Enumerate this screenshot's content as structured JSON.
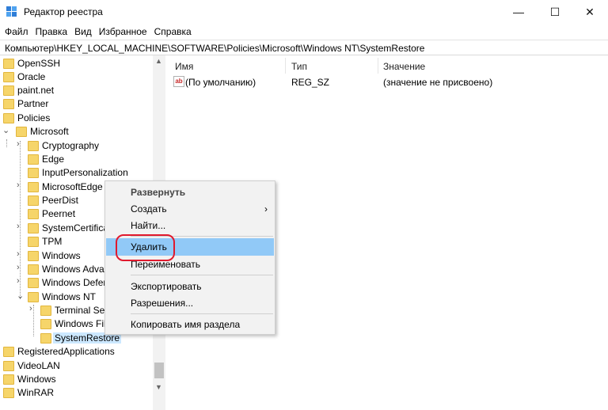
{
  "window": {
    "title": "Редактор реестра",
    "minimize_glyph": "—",
    "maximize_glyph": "☐",
    "close_glyph": "✕"
  },
  "menubar": [
    "Файл",
    "Правка",
    "Вид",
    "Избранное",
    "Справка"
  ],
  "address": "Компьютер\\HKEY_LOCAL_MACHINE\\SOFTWARE\\Policies\\Microsoft\\Windows NT\\SystemRestore",
  "tree": [
    {
      "label": "OpenSSH"
    },
    {
      "label": "Oracle"
    },
    {
      "label": "paint.net"
    },
    {
      "label": "Partner"
    },
    {
      "label": "Policies"
    },
    {
      "label": "Microsoft"
    },
    {
      "label": "Cryptography"
    },
    {
      "label": "Edge"
    },
    {
      "label": "InputPersonalization"
    },
    {
      "label": "MicrosoftEdge"
    },
    {
      "label": "PeerDist"
    },
    {
      "label": "Peernet"
    },
    {
      "label": "SystemCertifica"
    },
    {
      "label": "TPM"
    },
    {
      "label": "Windows"
    },
    {
      "label": "Windows Advan"
    },
    {
      "label": "Windows Defen"
    },
    {
      "label": "Windows NT"
    },
    {
      "label": "Terminal Ser"
    },
    {
      "label": "Windows Fil"
    },
    {
      "label": "SystemRestore"
    },
    {
      "label": "RegisteredApplications"
    },
    {
      "label": "VideoLAN"
    },
    {
      "label": "Windows"
    },
    {
      "label": "WinRAR"
    }
  ],
  "list": {
    "columns": [
      "Имя",
      "Тип",
      "Значение"
    ],
    "rows": [
      {
        "icon": "ab",
        "name": "(По умолчанию)",
        "type": "REG_SZ",
        "value": "(значение не присвоено)"
      }
    ]
  },
  "context_menu": {
    "items": [
      {
        "label": "Развернуть",
        "bold": true
      },
      {
        "label": "Создать",
        "submenu_glyph": "›"
      },
      {
        "label": "Найти..."
      },
      {
        "label": "Удалить",
        "highlighted": true
      },
      {
        "label": "Переименовать"
      },
      {
        "label": "Экспортировать"
      },
      {
        "label": "Разрешения..."
      },
      {
        "label": "Копировать имя раздела"
      }
    ],
    "highlight_color": "#91c9f7",
    "annotation_color": "#e0192d"
  },
  "glyphs": {
    "chevron_right": "›",
    "chevron_down": "⌄",
    "scroll_up": "▲",
    "scroll_down": "▼"
  }
}
